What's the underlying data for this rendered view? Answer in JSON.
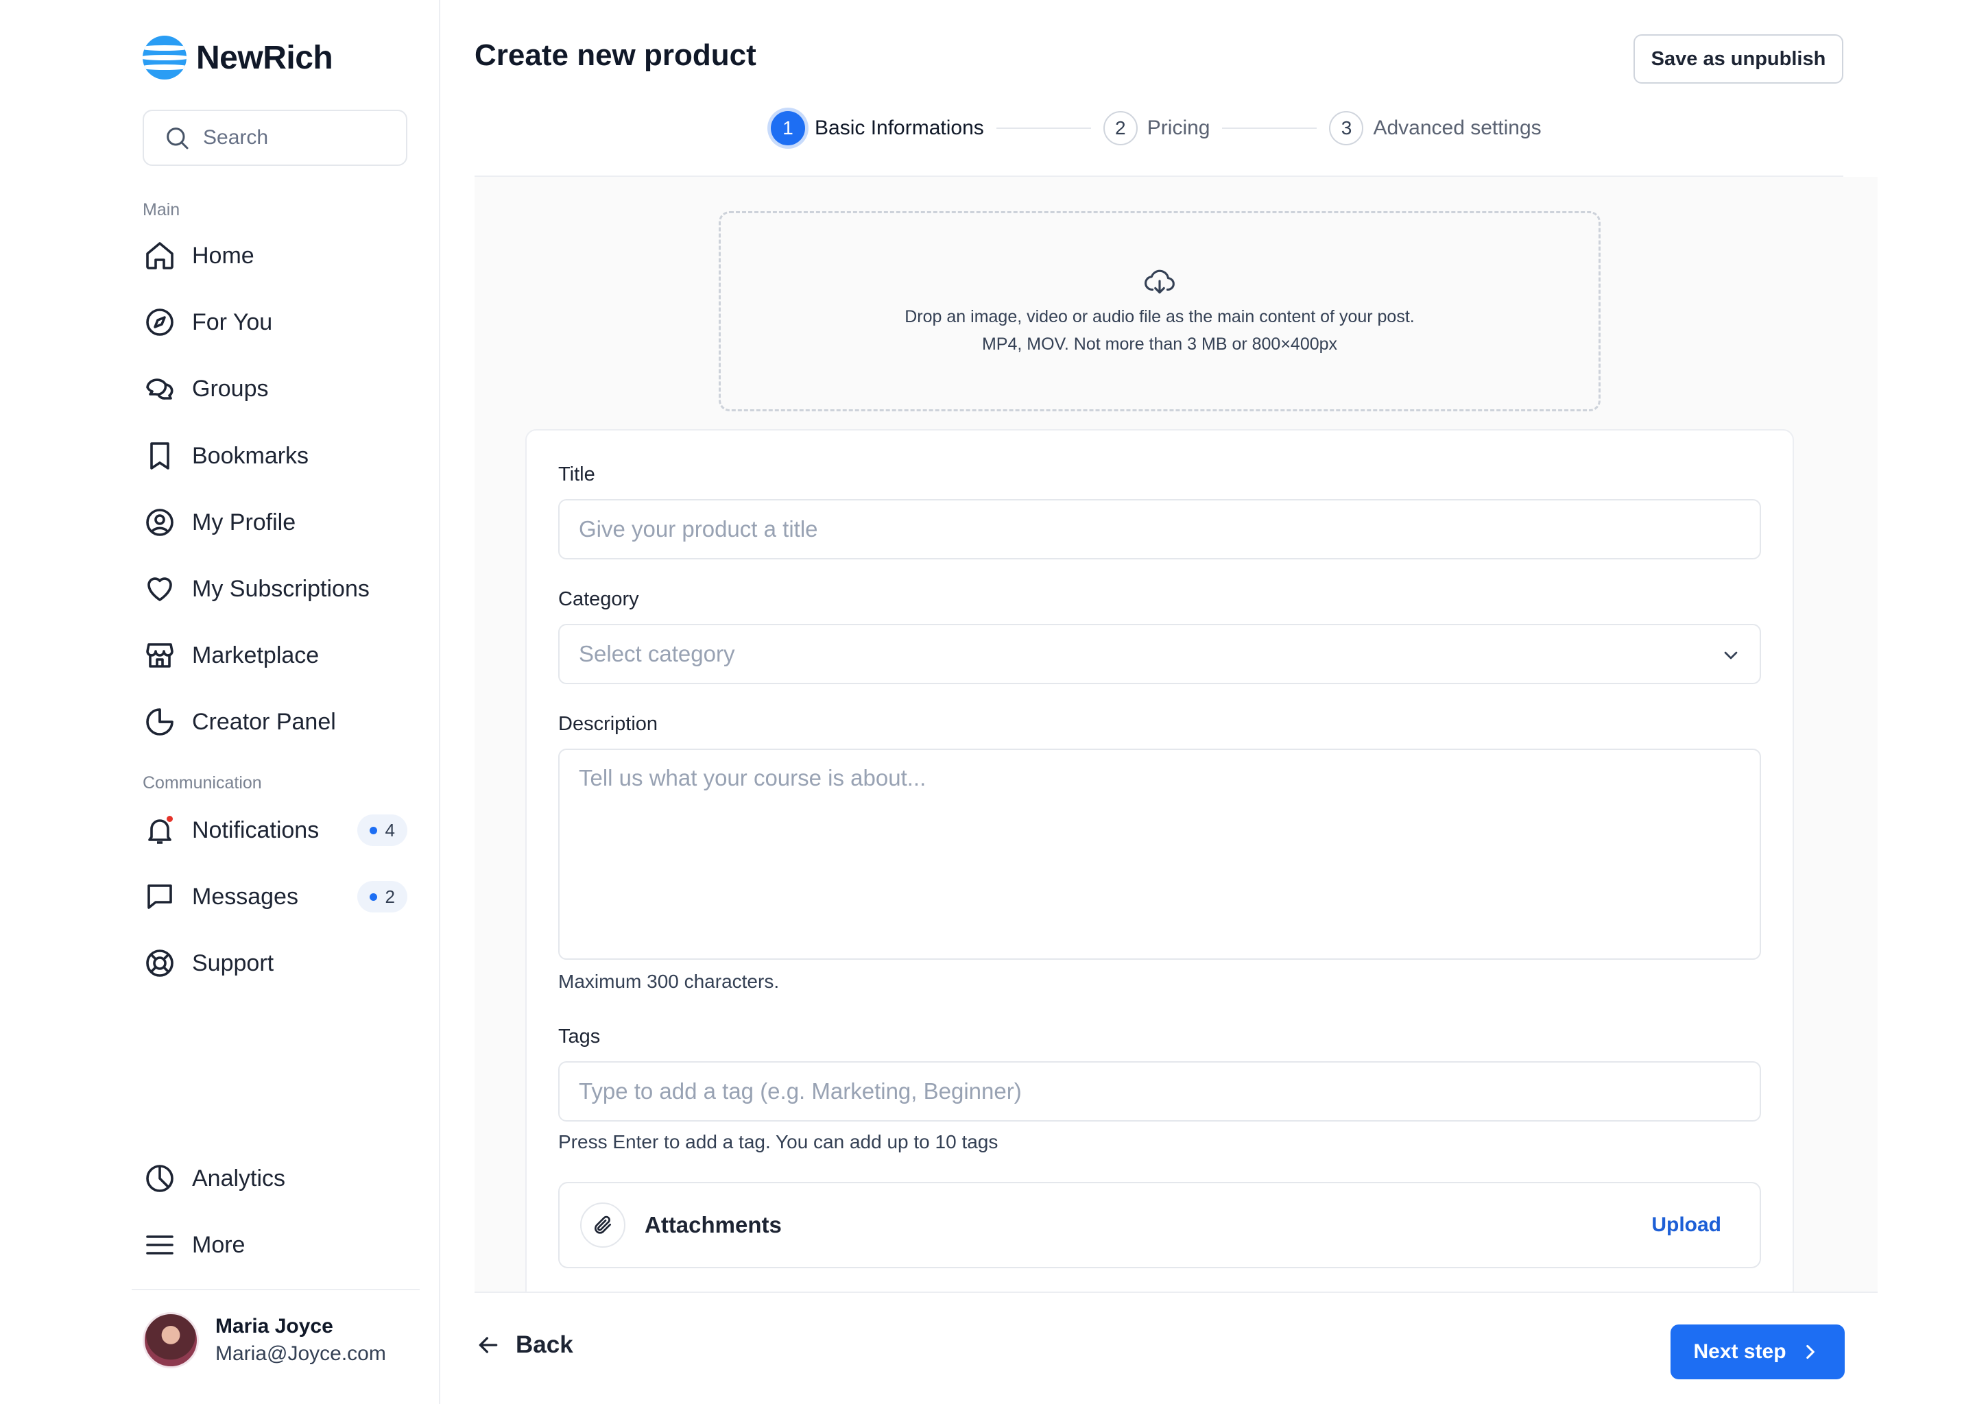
{
  "brand": {
    "name": "NewRich"
  },
  "search": {
    "placeholder": "Search"
  },
  "sidebar": {
    "main_label": "Main",
    "main_items": [
      {
        "label": "Home",
        "icon": "home-icon"
      },
      {
        "label": "For You",
        "icon": "compass-icon"
      },
      {
        "label": "Groups",
        "icon": "chat-bubbles-icon"
      },
      {
        "label": "Bookmarks",
        "icon": "bookmark-icon"
      },
      {
        "label": "My Profile",
        "icon": "user-circle-icon"
      },
      {
        "label": "My Subscriptions",
        "icon": "heart-icon"
      },
      {
        "label": "Marketplace",
        "icon": "store-icon"
      },
      {
        "label": "Creator Panel",
        "icon": "pie-chart-icon"
      }
    ],
    "communication_label": "Communication",
    "communication_items": [
      {
        "label": "Notifications",
        "icon": "bell-icon",
        "count": "4"
      },
      {
        "label": "Messages",
        "icon": "message-icon",
        "count": "2"
      },
      {
        "label": "Support",
        "icon": "lifebuoy-icon"
      }
    ],
    "bottom_items": [
      {
        "label": "Analytics",
        "icon": "clock-chart-icon"
      },
      {
        "label": "More",
        "icon": "menu-icon"
      }
    ],
    "user": {
      "name": "Maria Joyce",
      "email": "Maria@Joyce.com"
    }
  },
  "header": {
    "title": "Create new product",
    "save_label": "Save as unpublish"
  },
  "stepper": [
    {
      "num": "1",
      "label": "Basic Informations",
      "active": true
    },
    {
      "num": "2",
      "label": "Pricing",
      "active": false
    },
    {
      "num": "3",
      "label": "Advanced settings",
      "active": false
    }
  ],
  "dropzone": {
    "line1": "Drop an image, video or audio file as the main content of your post.",
    "line2": "MP4, MOV. Not more than 3 MB or 800×400px"
  },
  "form": {
    "title_label": "Title",
    "title_placeholder": "Give your product a title",
    "category_label": "Category",
    "category_placeholder": "Select category",
    "description_label": "Description",
    "description_placeholder": "Tell us what your course is about...",
    "description_help": "Maximum 300 characters.",
    "tags_label": "Tags",
    "tags_placeholder": "Type to add a tag (e.g. Marketing, Beginner)",
    "tags_help": "Press Enter to add a tag. You can add up to 10 tags",
    "attachments_label": "Attachments",
    "upload_label": "Upload"
  },
  "footer": {
    "back_label": "Back",
    "next_label": "Next step"
  },
  "colors": {
    "accent": "#1d6ef3",
    "notification_dot": "#e5332a",
    "logo": "#2a9df4"
  }
}
